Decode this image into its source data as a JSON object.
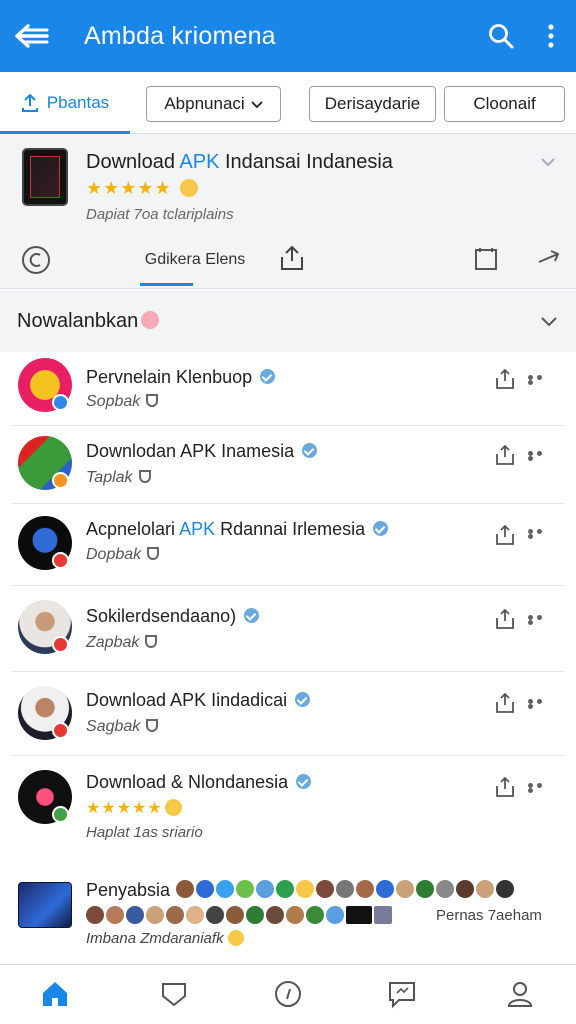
{
  "appbar": {
    "title": "Ambda kriomena",
    "bg_color": "#1a86e8",
    "icons": [
      "back-arrow-icon",
      "search-icon",
      "more-vert-icon"
    ]
  },
  "tabs": {
    "home_label": "Pbantas",
    "chips": [
      "Abpnunaci",
      "Derisaydarie",
      "Cloonaif"
    ]
  },
  "featured": {
    "title_pre": "Download ",
    "title_apk": "APK",
    "title_post": " Indansai Indanesia",
    "stars": "★★★★★",
    "subtitle": "Dapiat 7oa tclariplains",
    "action_label": "Gdikera Elens"
  },
  "section": {
    "title": "Nowalanbkan"
  },
  "list": [
    {
      "name": "Pervnelain Klenbuop",
      "meta": "Sopbak",
      "verified": true,
      "avatar_color": "#e81f63",
      "badge_color": "#2d8ae6"
    },
    {
      "name": "Downlodan APK Inamesia",
      "meta": "Taplak",
      "verified": true,
      "avatar_color": "#3a9a3a",
      "badge_color": "#f29424"
    },
    {
      "name_pre": "Acpnelolari ",
      "name_apk": "APK",
      "name_post": " Rdannai Irlemesia",
      "meta": "Dopbak",
      "verified": true,
      "avatar_color": "#0b0b0b",
      "badge_color": "#e53935"
    },
    {
      "name": "Sokilerdsendaano)",
      "meta": "Zapbak",
      "verified": true,
      "avatar_color": "#8a6a56",
      "badge_color": "#e53935"
    },
    {
      "name": "Download APK Iindadicai",
      "meta": "Sagbak",
      "verified": true,
      "avatar_color": "#2a2a2a",
      "badge_color": "#e53935"
    },
    {
      "name": "Download & Nlondanesia",
      "stars": "★★★★★",
      "meta": "Haplat 1as sriario",
      "verified": true,
      "avatar_color": "#0f0f0f",
      "badge_color": "#43a047"
    }
  ],
  "last_item": {
    "name": "Penyabsia",
    "right_text": "Pernas 7aeham",
    "meta": "Imbana Zmdaraniafk"
  },
  "bottom_nav": [
    "home-icon",
    "shield-icon",
    "compass-icon",
    "chat-bubble-icon",
    "profile-icon"
  ]
}
